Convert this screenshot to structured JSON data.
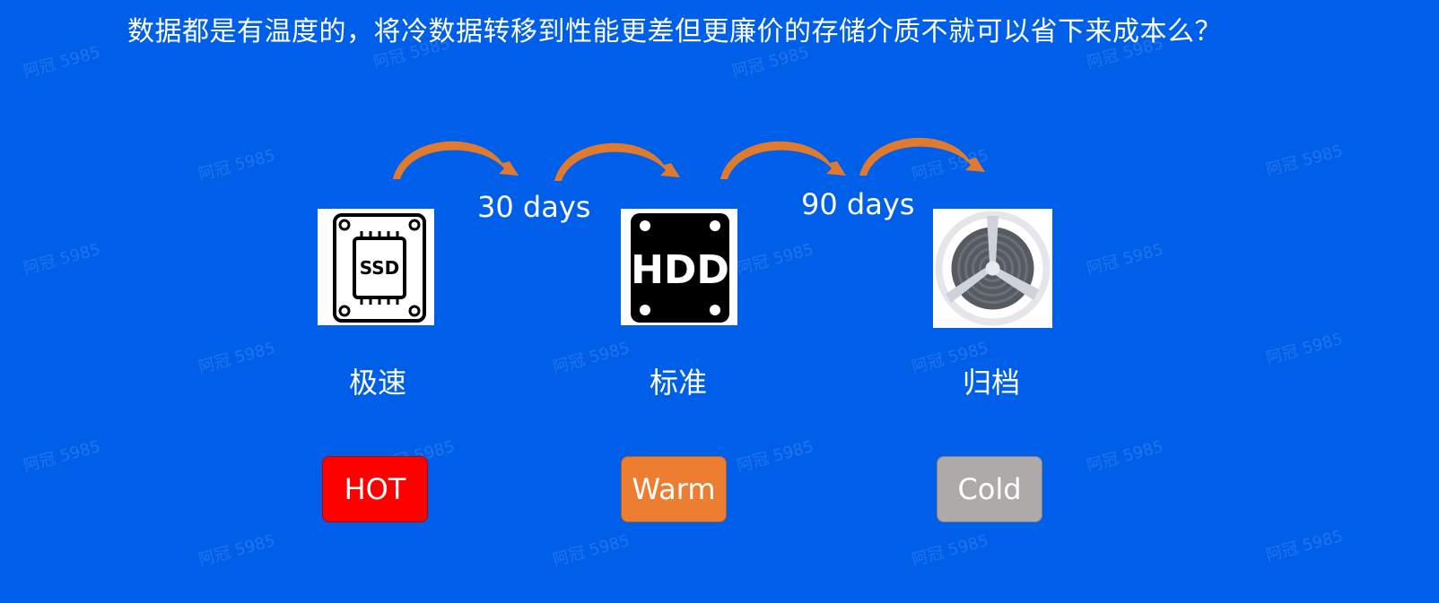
{
  "title": "数据都是有温度的，将冷数据转移到性能更差但更廉价的存储介质不就可以省下来成本么？",
  "watermark": "阿冠 5985",
  "transitions": [
    {
      "label": "30 days"
    },
    {
      "label": "90 days"
    }
  ],
  "tiers": [
    {
      "icon": "ssd-icon",
      "icon_text": "SSD",
      "label": "极速",
      "badge": "HOT",
      "badge_color": "#ff0000"
    },
    {
      "icon": "hdd-icon",
      "icon_text": "HDD",
      "label": "标准",
      "badge": "Warm",
      "badge_color": "#ed7d31"
    },
    {
      "icon": "archive-tape-icon",
      "icon_text": "",
      "label": "归档",
      "badge": "Cold",
      "badge_color": "#aeaaaa"
    }
  ],
  "colors": {
    "background": "#005fe9",
    "arrow": "#e07a2e"
  }
}
